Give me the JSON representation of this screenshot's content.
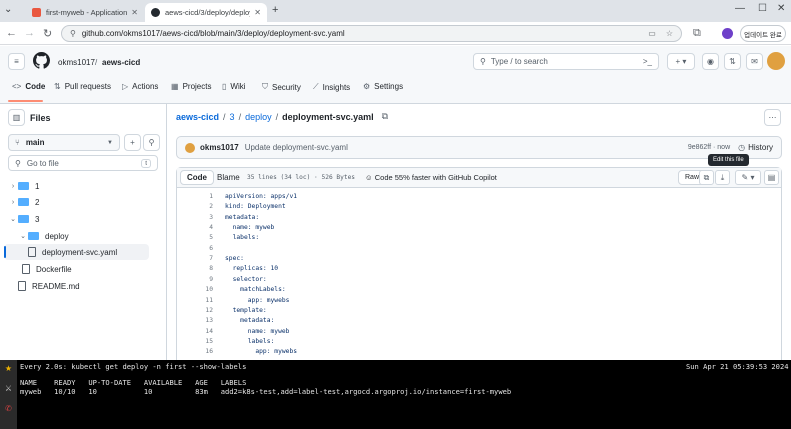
{
  "browser": {
    "tabs": [
      {
        "title": "first-myweb - Application Details",
        "active": false
      },
      {
        "title": "aews-cicd/3/deploy/deployment-svc.yaml",
        "active": true
      }
    ],
    "new_tab": "+",
    "url": "github.com/okms1017/aews-cicd/blob/main/3/deploy/deployment-svc.yaml",
    "update_label": "업데이트 완료"
  },
  "header": {
    "owner": "okms1017",
    "repo": "aews-cicd",
    "search_placeholder": "Type / to search"
  },
  "repo_tabs": [
    {
      "label": "Code",
      "icon": "code-icon"
    },
    {
      "label": "Pull requests",
      "icon": "pull-request-icon"
    },
    {
      "label": "Actions",
      "icon": "play-icon"
    },
    {
      "label": "Projects",
      "icon": "table-icon"
    },
    {
      "label": "Wiki",
      "icon": "book-icon"
    },
    {
      "label": "Security",
      "icon": "shield-icon"
    },
    {
      "label": "Insights",
      "icon": "graph-icon"
    },
    {
      "label": "Settings",
      "icon": "gear-icon"
    }
  ],
  "sidebar": {
    "title": "Files",
    "branch": "main",
    "goto_placeholder": "Go to file",
    "goto_shortcut": "t",
    "tree": [
      {
        "label": "1",
        "type": "folder",
        "expanded": false
      },
      {
        "label": "2",
        "type": "folder",
        "expanded": false
      },
      {
        "label": "3",
        "type": "folder",
        "expanded": true
      },
      {
        "label": "deploy",
        "type": "folder",
        "expanded": true
      },
      {
        "label": "deployment-svc.yaml",
        "type": "file",
        "selected": true
      },
      {
        "label": "Dockerfile",
        "type": "file"
      },
      {
        "label": "README.md",
        "type": "file"
      }
    ]
  },
  "breadcrumb": {
    "repo": "aews-cicd",
    "sep": "/",
    "dir1": "3",
    "dir2": "deploy",
    "file": "deployment-svc.yaml"
  },
  "commit": {
    "author": "okms1017",
    "message": "Update deployment-svc.yaml",
    "sha_time": "9e862ff · now",
    "history": "History"
  },
  "tooltip": "Edit this file",
  "code_toolbar": {
    "code_tab": "Code",
    "blame_tab": "Blame",
    "meta": "35 lines (34 loc) · 526 Bytes",
    "copilot": "Code 55% faster with GitHub Copilot",
    "raw": "Raw"
  },
  "code_lines": [
    {
      "n": "1",
      "text": "apiVersion: apps/v1"
    },
    {
      "n": "2",
      "text": "kind: Deployment"
    },
    {
      "n": "3",
      "text": "metadata:"
    },
    {
      "n": "4",
      "text": "  name: myweb"
    },
    {
      "n": "5",
      "text": "  labels:"
    },
    {
      "n": "6",
      "text": ""
    },
    {
      "n": "7",
      "text": "spec:"
    },
    {
      "n": "8",
      "text": "  replicas: 10"
    },
    {
      "n": "9",
      "text": "  selector:"
    },
    {
      "n": "10",
      "text": "    matchLabels:"
    },
    {
      "n": "11",
      "text": "      app: mywebs"
    },
    {
      "n": "12",
      "text": "  template:"
    },
    {
      "n": "13",
      "text": "    metadata:"
    },
    {
      "n": "14",
      "text": "      name: myweb"
    },
    {
      "n": "15",
      "text": "      labels:"
    },
    {
      "n": "16",
      "text": "        app: mywebs"
    }
  ],
  "terminal": {
    "command": "Every 2.0s: kubectl get deploy -n first --show-labels",
    "timestamp": "Sun Apr 21 05:39:53 2024",
    "header_row": "NAME    READY   UP-TO-DATE   AVAILABLE   AGE   LABELS",
    "data_row": "myweb   10/10   10           10          83m   add2=k8s-test,add=label-test,argocd.argoproj.io/instance=first-myweb"
  }
}
